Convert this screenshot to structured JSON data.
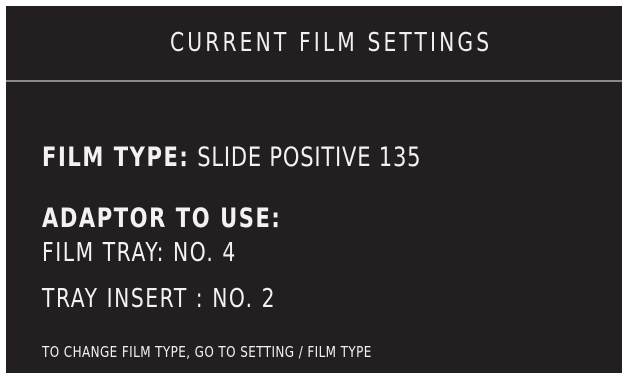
{
  "header": {
    "title": "CURRENT FILM SETTINGS"
  },
  "settings": {
    "film_type_label": "FILM TYPE:",
    "film_type_value": "SLIDE POSITIVE 135",
    "adaptor_heading": "ADAPTOR TO USE:",
    "film_tray": "FILM TRAY: NO. 4",
    "tray_insert": "TRAY INSERT : NO. 2"
  },
  "footer": {
    "hint": "TO CHANGE FILM TYPE, GO TO SETTING / FILM TYPE"
  }
}
